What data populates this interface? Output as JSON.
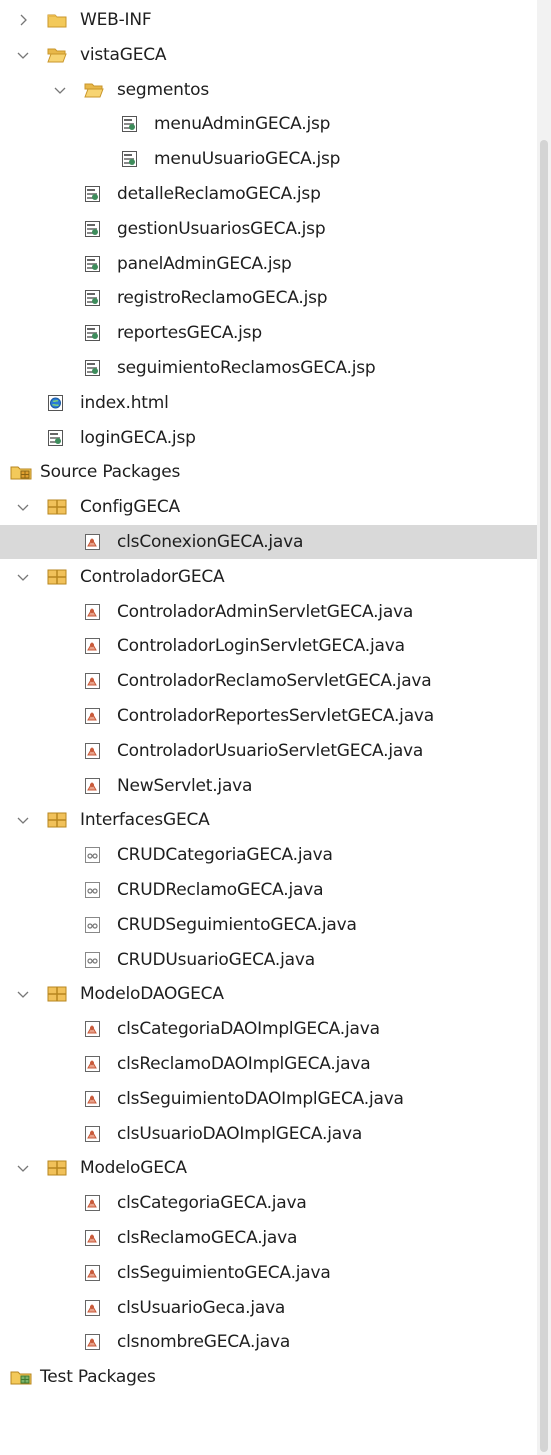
{
  "tree": [
    {
      "label": "WEB-INF",
      "level": 1,
      "icon": "folder-icon",
      "chevron": "right"
    },
    {
      "label": "vistaGECA",
      "level": 1,
      "icon": "folder-open-icon",
      "chevron": "down"
    },
    {
      "label": "segmentos",
      "level": 2,
      "icon": "folder-open-icon",
      "chevron": "down"
    },
    {
      "label": "menuAdminGECA.jsp",
      "level": 3,
      "icon": "jsp-file-icon"
    },
    {
      "label": "menuUsuarioGECA.jsp",
      "level": 3,
      "icon": "jsp-file-icon"
    },
    {
      "label": "detalleReclamoGECA.jsp",
      "level": 2,
      "icon": "jsp-file-icon"
    },
    {
      "label": "gestionUsuariosGECA.jsp",
      "level": 2,
      "icon": "jsp-file-icon"
    },
    {
      "label": "panelAdminGECA.jsp",
      "level": 2,
      "icon": "jsp-file-icon"
    },
    {
      "label": "registroReclamoGECA.jsp",
      "level": 2,
      "icon": "jsp-file-icon"
    },
    {
      "label": "reportesGECA.jsp",
      "level": 2,
      "icon": "jsp-file-icon"
    },
    {
      "label": "seguimientoReclamosGECA.jsp",
      "level": 2,
      "icon": "jsp-file-icon"
    },
    {
      "label": "index.html",
      "level": 1,
      "icon": "html-file-icon"
    },
    {
      "label": "loginGECA.jsp",
      "level": 1,
      "icon": "jsp-file-icon"
    },
    {
      "label": "Source Packages",
      "level": 0,
      "icon": "source-packages-icon"
    },
    {
      "label": "ConfigGECA",
      "level": 1,
      "icon": "package-icon",
      "chevron": "down"
    },
    {
      "label": "clsConexionGECA.java",
      "level": 2,
      "icon": "java-class-icon",
      "selected": true
    },
    {
      "label": "ControladorGECA",
      "level": 1,
      "icon": "package-icon",
      "chevron": "down"
    },
    {
      "label": "ControladorAdminServletGECA.java",
      "level": 2,
      "icon": "java-class-icon"
    },
    {
      "label": "ControladorLoginServletGECA.java",
      "level": 2,
      "icon": "java-class-icon"
    },
    {
      "label": "ControladorReclamoServletGECA.java",
      "level": 2,
      "icon": "java-class-icon"
    },
    {
      "label": "ControladorReportesServletGECA.java",
      "level": 2,
      "icon": "java-class-icon"
    },
    {
      "label": "ControladorUsuarioServletGECA.java",
      "level": 2,
      "icon": "java-class-icon"
    },
    {
      "label": "NewServlet.java",
      "level": 2,
      "icon": "java-class-icon"
    },
    {
      "label": "InterfacesGECA",
      "level": 1,
      "icon": "package-icon",
      "chevron": "down"
    },
    {
      "label": "CRUDCategoriaGECA.java",
      "level": 2,
      "icon": "java-interface-icon"
    },
    {
      "label": "CRUDReclamoGECA.java",
      "level": 2,
      "icon": "java-interface-icon"
    },
    {
      "label": "CRUDSeguimientoGECA.java",
      "level": 2,
      "icon": "java-interface-icon"
    },
    {
      "label": "CRUDUsuarioGECA.java",
      "level": 2,
      "icon": "java-interface-icon"
    },
    {
      "label": "ModeloDAOGECA",
      "level": 1,
      "icon": "package-icon",
      "chevron": "down"
    },
    {
      "label": "clsCategoriaDAOImplGECA.java",
      "level": 2,
      "icon": "java-class-icon"
    },
    {
      "label": "clsReclamoDAOImplGECA.java",
      "level": 2,
      "icon": "java-class-icon"
    },
    {
      "label": "clsSeguimientoDAOImplGECA.java",
      "level": 2,
      "icon": "java-class-icon"
    },
    {
      "label": "clsUsuarioDAOImplGECA.java",
      "level": 2,
      "icon": "java-class-icon"
    },
    {
      "label": "ModeloGECA",
      "level": 1,
      "icon": "package-icon",
      "chevron": "down"
    },
    {
      "label": "clsCategoriaGECA.java",
      "level": 2,
      "icon": "java-class-icon"
    },
    {
      "label": "clsReclamoGECA.java",
      "level": 2,
      "icon": "java-class-icon"
    },
    {
      "label": "clsSeguimientoGECA.java",
      "level": 2,
      "icon": "java-class-icon"
    },
    {
      "label": "clsUsuarioGeca.java",
      "level": 2,
      "icon": "java-class-icon"
    },
    {
      "label": "clsnombreGECA.java",
      "level": 2,
      "icon": "java-class-icon"
    },
    {
      "label": "Test Packages",
      "level": 0,
      "icon": "test-packages-icon"
    }
  ],
  "colors": {
    "selection": "#d9d9d9",
    "folder": "#e8b84a",
    "package": "#e0a030",
    "java_accent": "#c85a3a",
    "html_accent": "#2a7bd6"
  }
}
